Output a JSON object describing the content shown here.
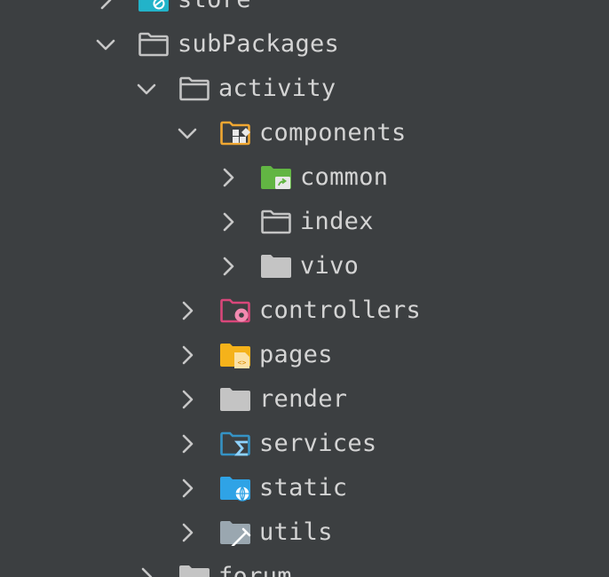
{
  "tree": {
    "nodes": [
      {
        "id": "store",
        "label": "store",
        "depth": 0,
        "expanded": false,
        "icon": "store-folder-icon"
      },
      {
        "id": "subPackages",
        "label": "subPackages",
        "depth": 0,
        "expanded": true,
        "icon": "folder-outline-icon"
      },
      {
        "id": "activity",
        "label": "activity",
        "depth": 1,
        "expanded": true,
        "icon": "folder-outline-icon"
      },
      {
        "id": "components",
        "label": "components",
        "depth": 2,
        "expanded": true,
        "icon": "components-folder-icon"
      },
      {
        "id": "common",
        "label": "common",
        "depth": 3,
        "expanded": false,
        "icon": "common-folder-icon"
      },
      {
        "id": "index",
        "label": "index",
        "depth": 3,
        "expanded": false,
        "icon": "folder-outline-icon"
      },
      {
        "id": "vivo",
        "label": "vivo",
        "depth": 3,
        "expanded": false,
        "icon": "folder-solid-icon"
      },
      {
        "id": "controllers",
        "label": "controllers",
        "depth": 2,
        "expanded": false,
        "icon": "controllers-folder-icon"
      },
      {
        "id": "pages",
        "label": "pages",
        "depth": 2,
        "expanded": false,
        "icon": "pages-folder-icon"
      },
      {
        "id": "render",
        "label": "render",
        "depth": 2,
        "expanded": false,
        "icon": "folder-solid-icon"
      },
      {
        "id": "services",
        "label": "services",
        "depth": 2,
        "expanded": false,
        "icon": "services-folder-icon"
      },
      {
        "id": "static",
        "label": "static",
        "depth": 2,
        "expanded": false,
        "icon": "static-folder-icon"
      },
      {
        "id": "utils",
        "label": "utils",
        "depth": 2,
        "expanded": false,
        "icon": "utils-folder-icon"
      },
      {
        "id": "forum",
        "label": "forum",
        "depth": 1,
        "expanded": false,
        "icon": "folder-solid-icon"
      }
    ]
  },
  "colors": {
    "background": "#3c3f41",
    "text": "#d4d4d4",
    "chevron": "#c7c7c7",
    "folder_grey": "#c4c4c4",
    "components_orange": "#f0a732",
    "common_green": "#62b543",
    "controllers_pink": "#d8477a",
    "pages_yellow": "#f5b21a",
    "services_blue": "#3592c4",
    "static_blue": "#2fa3e6",
    "utils_slate": "#9aa7b0",
    "store_teal": "#22b3c9"
  }
}
